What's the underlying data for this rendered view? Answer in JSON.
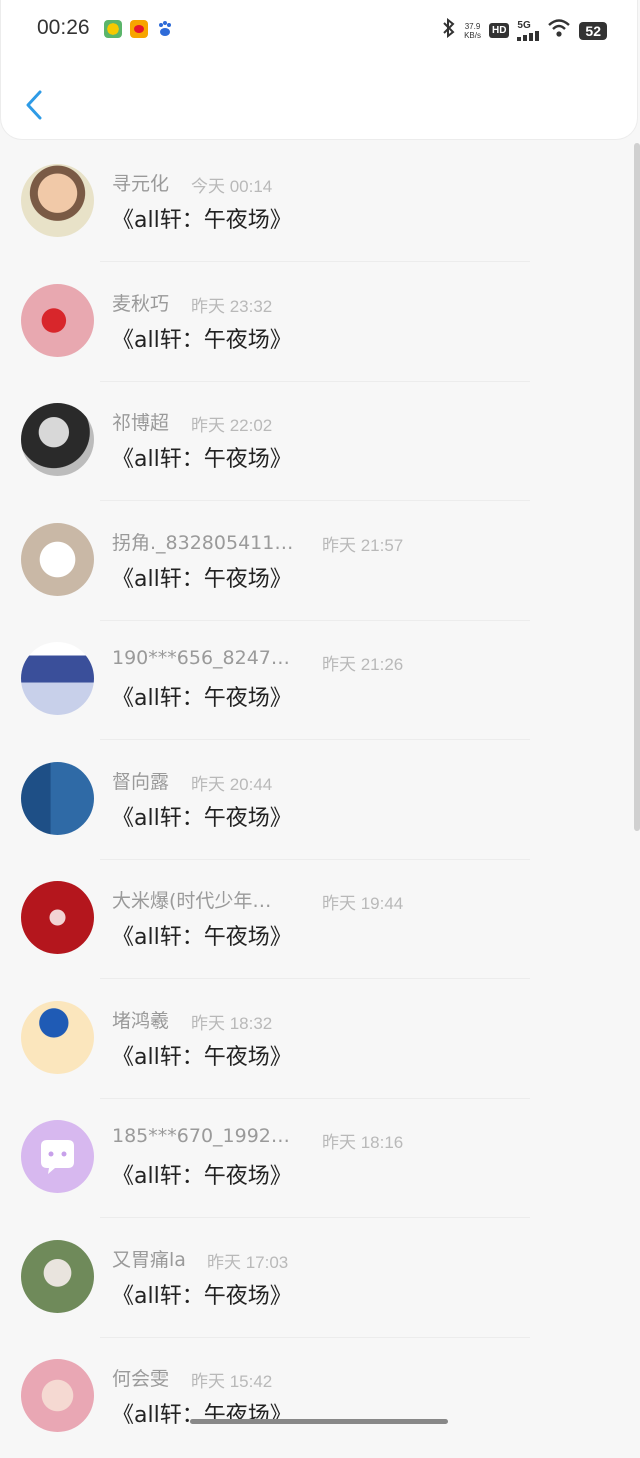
{
  "status_bar": {
    "time": "00:26",
    "net_speed_value": "37.9",
    "net_speed_unit": "KB/s",
    "hd": "HD",
    "signal": "5G",
    "battery": "52"
  },
  "list": [
    {
      "name": "寻元化",
      "time": "今天 00:14",
      "message": "《all轩：午夜场》"
    },
    {
      "name": "麦秋巧",
      "time": "昨天 23:32",
      "message": "《all轩：午夜场》"
    },
    {
      "name": "祁博超",
      "time": "昨天 22:02",
      "message": "《all轩：午夜场》"
    },
    {
      "name": "拐角._832805411…",
      "time": "昨天 21:57",
      "message": "《all轩：午夜场》"
    },
    {
      "name": "190***656_8247…",
      "time": "昨天 21:26",
      "message": "《all轩：午夜场》"
    },
    {
      "name": "督向露",
      "time": "昨天 20:44",
      "message": "《all轩：午夜场》"
    },
    {
      "name": "大米爆(时代少年…",
      "time": "昨天 19:44",
      "message": "《all轩：午夜场》"
    },
    {
      "name": "堵鸿羲",
      "time": "昨天 18:32",
      "message": "《all轩：午夜场》"
    },
    {
      "name": "185***670_1992…",
      "time": "昨天 18:16",
      "message": "《all轩：午夜场》"
    },
    {
      "name": "又胃痛la",
      "time": "昨天 17:03",
      "message": "《all轩：午夜场》"
    },
    {
      "name": "何会雯",
      "time": "昨天 15:42",
      "message": "《all轩：午夜场》"
    }
  ],
  "colors": {
    "accent": "#2e9be6",
    "name_text": "#9a9a9a",
    "time_text": "#b9b9b9",
    "message_text": "#222222",
    "background": "#f7f7f7"
  }
}
